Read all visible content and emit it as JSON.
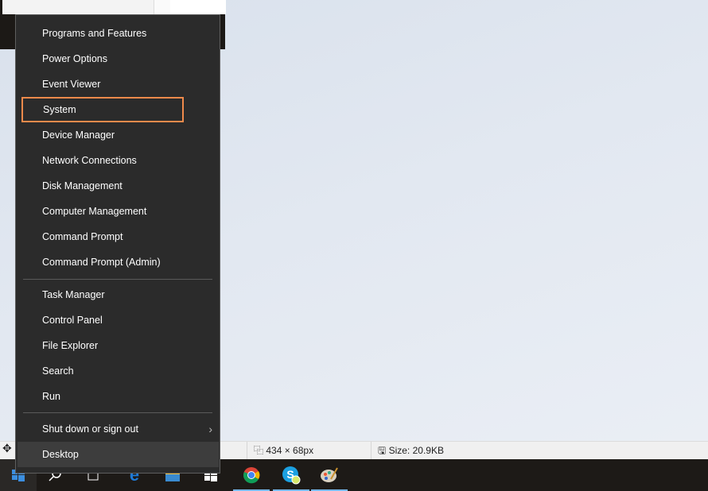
{
  "menu": {
    "group1": [
      "Programs and Features",
      "Power Options",
      "Event Viewer",
      "System",
      "Device Manager",
      "Network Connections",
      "Disk Management",
      "Computer Management",
      "Command Prompt",
      "Command Prompt (Admin)"
    ],
    "group2": [
      "Task Manager",
      "Control Panel",
      "File Explorer",
      "Search",
      "Run"
    ],
    "shutdown": "Shut down or sign out",
    "desktop": "Desktop",
    "selected": "System",
    "highlight_color": "#f08a4b"
  },
  "status": {
    "dimensions": "434 × 68px",
    "size": "Size: 20.9KB"
  },
  "taskbar": {
    "icons": [
      "windows-start-icon",
      "search-icon",
      "task-view-icon",
      "edge-icon",
      "store-icon",
      "windows-icon",
      "chrome-icon",
      "skype-icon",
      "paint-icon"
    ]
  }
}
